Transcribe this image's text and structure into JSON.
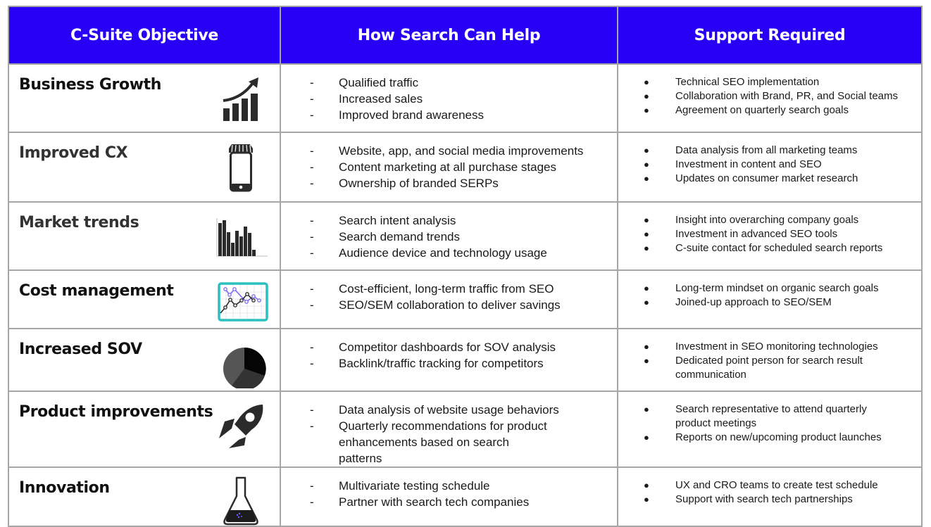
{
  "header": {
    "col1": "C-Suite Objective",
    "col2": "How Search Can Help",
    "col3": "Support Required"
  },
  "colors": {
    "header_bg": "#2800f5",
    "header_text": "#ffffff",
    "border": "#a6a6a6",
    "accent_teal": "#2bbfbf",
    "accent_purple": "#7b6cf0"
  },
  "rows": [
    {
      "objective": "Business Growth",
      "icon": "growth-chart-icon",
      "help": [
        "Qualified traffic",
        "Increased sales",
        "Improved brand awareness"
      ],
      "support": [
        "Technical SEO implementation",
        "Collaboration with Brand, PR, and Social teams",
        "Agreement on quarterly search goals"
      ]
    },
    {
      "objective": "Improved CX",
      "icon": "mobile-store-icon",
      "help": [
        "Website, app, and social media improvements",
        "Content marketing at all purchase stages",
        "Ownership of branded SERPs"
      ],
      "support": [
        "Data analysis from all marketing teams",
        "Investment in content and SEO",
        "Updates on consumer market research"
      ]
    },
    {
      "objective": "Market trends",
      "icon": "bar-chart-icon",
      "help": [
        "Search intent analysis",
        "Search demand trends",
        "Audience device and technology usage"
      ],
      "support": [
        "Insight into overarching company goals",
        "Investment in advanced SEO tools",
        "C-suite contact for scheduled search reports"
      ]
    },
    {
      "objective": "Cost management",
      "icon": "line-chart-icon",
      "help": [
        "Cost-efficient, long-term traffic from SEO",
        "SEO/SEM collaboration to deliver savings"
      ],
      "support": [
        "Long-term mindset on organic search goals",
        "Joined-up approach to SEO/SEM"
      ]
    },
    {
      "objective": "Increased SOV",
      "icon": "pie-chart-icon",
      "help": [
        "Competitor dashboards for SOV analysis",
        "Backlink/traffic tracking for competitors"
      ],
      "support": [
        "Investment in SEO monitoring technologies",
        "Dedicated point person for search result communication"
      ]
    },
    {
      "objective": "Product improvements",
      "icon": "rocket-icon",
      "help": [
        "Data analysis of website usage behaviors",
        "Quarterly recommendations for product enhancements based on search patterns"
      ],
      "support": [
        "Search representative to attend quarterly product meetings",
        "Reports on new/upcoming product launches"
      ]
    },
    {
      "objective": "Innovation",
      "icon": "flask-icon",
      "help": [
        "Multivariate testing schedule",
        "Partner with search tech companies"
      ],
      "support": [
        "UX and CRO teams to create test schedule",
        "Support with search tech partnerships"
      ]
    }
  ],
  "markers": {
    "help": "-",
    "support": "●"
  }
}
